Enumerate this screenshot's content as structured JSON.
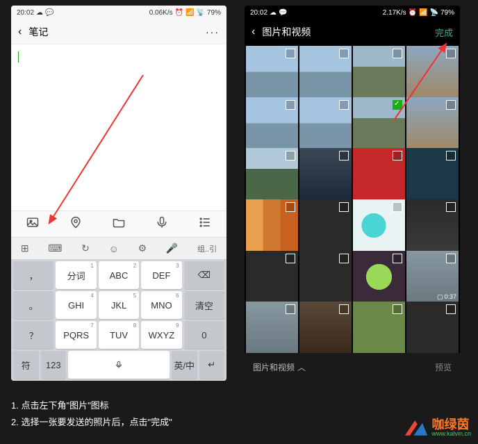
{
  "status": {
    "time": "20:02",
    "speed_left": "0.06K/s",
    "speed_right": "2.17K/s",
    "battery": "79%"
  },
  "left_phone": {
    "title": "笔记",
    "toolbar": [
      "image",
      "location",
      "folder",
      "mic",
      "list"
    ],
    "kb_top": [
      "grid",
      "keyboard",
      "refresh",
      "smile",
      "gear",
      "voice",
      "pinyin"
    ]
  },
  "keyboard": {
    "rows": [
      [
        {
          "l": "，",
          "sub": "",
          "g": 1
        },
        {
          "l": "分词",
          "sub": "1"
        },
        {
          "l": "ABC",
          "sub": "2"
        },
        {
          "l": "DEF",
          "sub": "3"
        },
        {
          "l": "⌫",
          "g": 1
        }
      ],
      [
        {
          "l": "。",
          "g": 1
        },
        {
          "l": "GHI",
          "sub": "4"
        },
        {
          "l": "JKL",
          "sub": "5"
        },
        {
          "l": "MNO",
          "sub": "6"
        },
        {
          "l": "清空",
          "g": 1
        }
      ],
      [
        {
          "l": "？",
          "g": 1
        },
        {
          "l": "PQRS",
          "sub": "7"
        },
        {
          "l": "TUV",
          "sub": "8"
        },
        {
          "l": "WXYZ",
          "sub": "9"
        },
        {
          "l": "0",
          "g": 1
        }
      ],
      [
        {
          "l": "符",
          "g": 1
        },
        {
          "l": "123",
          "g": 1
        },
        {
          "l": "space",
          "space": 1
        },
        {
          "l": "英/中",
          "g": 1
        },
        {
          "l": "↵",
          "g": 1
        }
      ]
    ]
  },
  "right_phone": {
    "title": "图片和视频",
    "done": "完成",
    "bottom_label": "图片和视频",
    "preview": "预览",
    "video_duration": "0:37"
  },
  "gallery_items": [
    {
      "c": "lake"
    },
    {
      "c": "lake"
    },
    {
      "c": "bridge"
    },
    {
      "c": "fence"
    },
    {
      "c": "lake"
    },
    {
      "c": "lake"
    },
    {
      "c": "bridge",
      "sel": true
    },
    {
      "c": "fence"
    },
    {
      "c": "trees"
    },
    {
      "c": "city"
    },
    {
      "c": "red-promo"
    },
    {
      "c": "teal-promo"
    },
    {
      "c": "food"
    },
    {
      "c": "dark-thumb"
    },
    {
      "c": "mascot"
    },
    {
      "c": "portrait"
    },
    {
      "c": "dark-thumb"
    },
    {
      "c": "dark-thumb"
    },
    {
      "c": "plant"
    },
    {
      "c": "dock",
      "vid": true
    },
    {
      "c": "dock"
    },
    {
      "c": "street"
    },
    {
      "c": "grass"
    },
    {
      "c": "dark-thumb"
    }
  ],
  "instructions": {
    "line1": "1. 点击左下角\"图片\"图标",
    "line2": "2. 选择一张要发送的照片后，点击\"完成\""
  },
  "watermark": {
    "main": "咖绿茵",
    "sub": "www.kalvin.cn"
  }
}
